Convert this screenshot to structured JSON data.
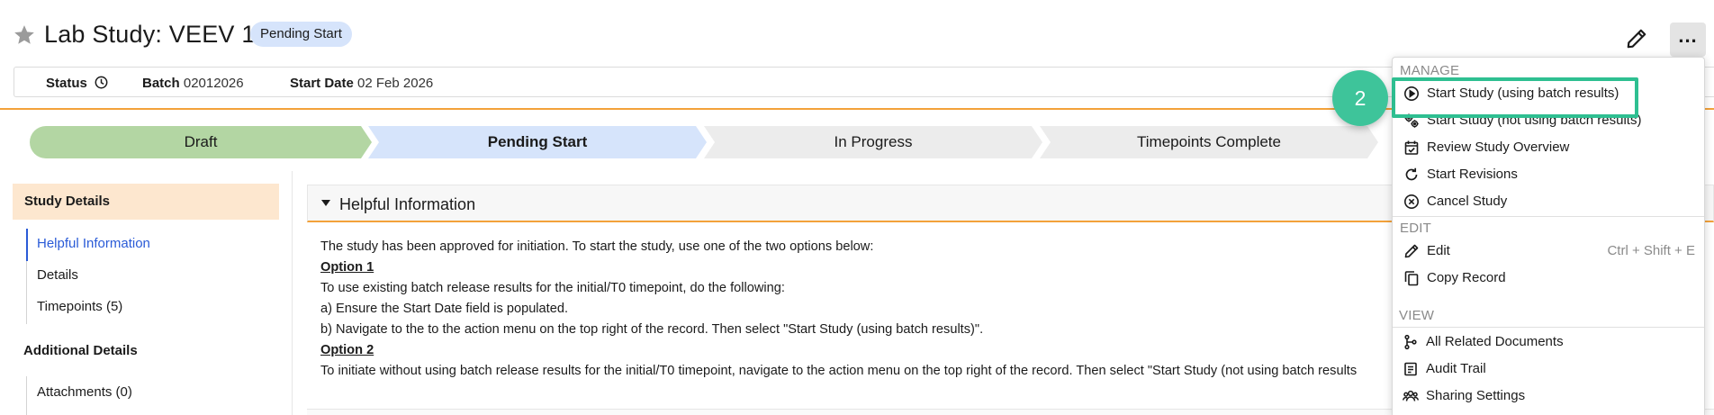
{
  "header": {
    "title": "Lab Study: VEEV 1",
    "status_pill": "Pending Start",
    "icons": {
      "favorite": "star-icon",
      "edit": "pencil-icon",
      "more": "more-actions-icon"
    },
    "more_glyph": "..."
  },
  "info_bar": {
    "status_label": "Status",
    "batch_label": "Batch",
    "batch_value": "02012026",
    "start_date_label": "Start Date",
    "start_date_value": "02 Feb 2026"
  },
  "lifecycle": {
    "steps": [
      {
        "label": "Draft",
        "state": "done"
      },
      {
        "label": "Pending Start",
        "state": "current"
      },
      {
        "label": "In Progress",
        "state": "todo"
      },
      {
        "label": "Timepoints Complete",
        "state": "todo"
      }
    ]
  },
  "left_nav": {
    "section_title": "Study Details",
    "items": [
      {
        "label": "Helpful Information",
        "active": true
      },
      {
        "label": "Details",
        "active": false
      },
      {
        "label": "Timepoints (5)",
        "active": false
      }
    ],
    "section2_title": "Additional Details",
    "items2": [
      {
        "label": "Attachments (0)"
      }
    ]
  },
  "helpful_info": {
    "title": "Helpful Information",
    "lines": [
      "The study has been approved for initiation. To start the study, use one of the two options below:",
      "Option 1",
      "To use existing batch release results for the initial/T0 timepoint, do the following:",
      "a) Ensure the Start Date field is populated.",
      "b) Navigate to the to the action menu on the top right of the record. Then select \"Start Study (using batch results)\".",
      "Option 2",
      "To initiate without using batch release results for the initial/T0 timepoint, navigate to the action menu on the top right of the record. Then select  \"Start Study (not using batch results"
    ]
  },
  "action_menu": {
    "groups": [
      {
        "label": "MANAGE",
        "items": [
          {
            "label": "Start Study (using batch results)",
            "icon": "play-circle-icon"
          },
          {
            "label": "Start Study (not using batch results)",
            "icon": "gears-icon"
          },
          {
            "label": "Review Study Overview",
            "icon": "calendar-check-icon"
          },
          {
            "label": "Start Revisions",
            "icon": "refresh-icon"
          },
          {
            "label": "Cancel Study",
            "icon": "cancel-circle-icon"
          }
        ]
      },
      {
        "label": "EDIT",
        "items": [
          {
            "label": "Edit",
            "icon": "pencil-icon",
            "shortcut": "Ctrl + Shift + E"
          },
          {
            "label": "Copy Record",
            "icon": "copy-icon"
          }
        ]
      },
      {
        "label": "VIEW",
        "items": [
          {
            "label": "All Related Documents",
            "icon": "related-documents-icon"
          },
          {
            "label": "Audit Trail",
            "icon": "audit-trail-icon"
          },
          {
            "label": "Sharing Settings",
            "icon": "users-icon"
          }
        ]
      }
    ]
  },
  "tutorial_badge": "2",
  "colors": {
    "accent_orange": "#f3a23a",
    "step_done": "#b3d6a3",
    "step_current": "#d6e4fb",
    "step_todo": "#ececec",
    "highlight_green": "#2ebf91",
    "link_blue": "#2a5bd7"
  }
}
